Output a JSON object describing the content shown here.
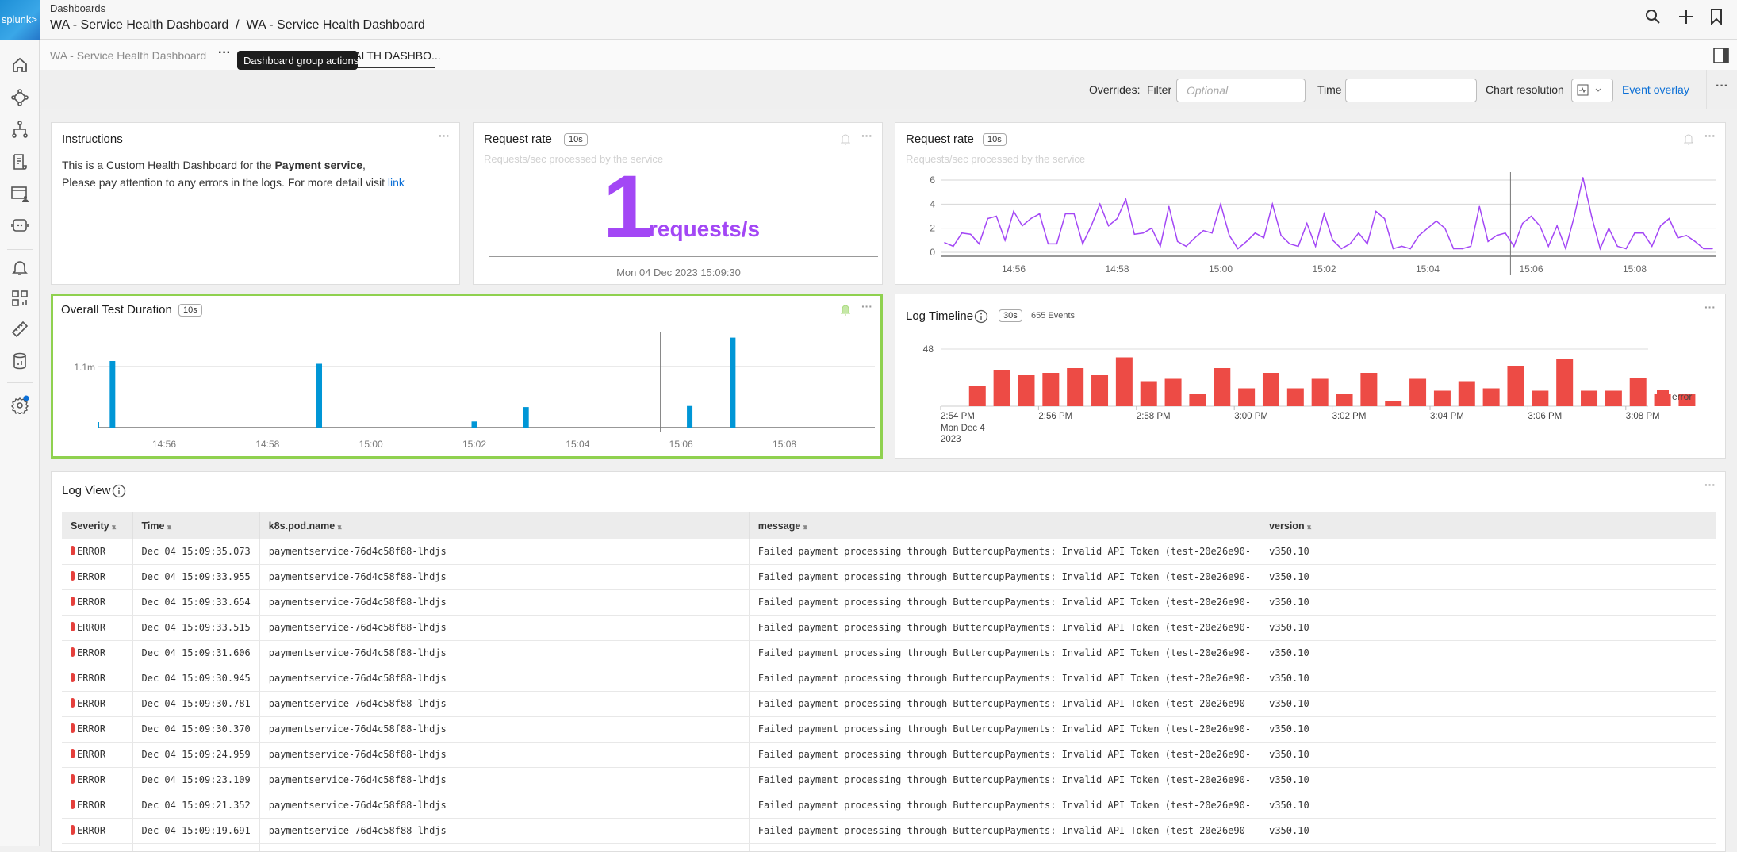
{
  "header": {
    "logo": "splunk>",
    "breadcrumb": "Dashboards",
    "title": "WA - Service Health Dashboard  /  WA - Service Health Dashboard",
    "icons": [
      "search-icon",
      "plus-icon",
      "bookmark-icon"
    ]
  },
  "sidebar": {
    "items": [
      "home",
      "service-map",
      "hierarchy",
      "logs",
      "synthetics",
      "bot",
      "alerts",
      "dashboards",
      "ruler",
      "database",
      "settings"
    ]
  },
  "tabs": {
    "group_name": "WA - Service Health Dashboard",
    "tooltip": "Dashboard group actions",
    "active_tab": "WA - SERVICE HEALTH DASHBO..."
  },
  "overrides": {
    "label": "Overrides:",
    "filter_label": "Filter",
    "filter_placeholder": "Optional",
    "filter_value": "",
    "time_label": "Time",
    "time_value": "",
    "resolution_label": "Chart resolution",
    "event_overlay": "Event overlay"
  },
  "colors": {
    "purple": "#a347f5",
    "blue": "#0096d6",
    "red": "#ed4b45",
    "highlight": "#8fd14f",
    "link": "#0b6fd6"
  },
  "instructions": {
    "title": "Instructions",
    "line1_pre": "This is a Custom Health Dashboard for the ",
    "line1_bold": "Payment service",
    "line1_post": ",",
    "line2": "Please pay attention to any errors in the logs. For more detail visit ",
    "link": "link"
  },
  "single_value": {
    "title": "Request rate",
    "resolution": "10s",
    "description": "Requests/sec processed by the service",
    "value": "1",
    "unit": "requests/s",
    "timestamp": "Mon 04 Dec 2023 15:09:30"
  },
  "log_view": {
    "title": "Log View",
    "columns": [
      "Severity",
      "Time",
      "k8s.pod.name",
      "message",
      "version"
    ],
    "rows": [
      [
        "ERROR",
        "Dec 04 15:09:35.073",
        "paymentservice-76d4c58f88-lhdjs",
        "Failed payment processing through ButtercupPayments: Invalid API Token (test-20e26e90-",
        "v350.10"
      ],
      [
        "ERROR",
        "Dec 04 15:09:33.955",
        "paymentservice-76d4c58f88-lhdjs",
        "Failed payment processing through ButtercupPayments: Invalid API Token (test-20e26e90-",
        "v350.10"
      ],
      [
        "ERROR",
        "Dec 04 15:09:33.654",
        "paymentservice-76d4c58f88-lhdjs",
        "Failed payment processing through ButtercupPayments: Invalid API Token (test-20e26e90-",
        "v350.10"
      ],
      [
        "ERROR",
        "Dec 04 15:09:33.515",
        "paymentservice-76d4c58f88-lhdjs",
        "Failed payment processing through ButtercupPayments: Invalid API Token (test-20e26e90-",
        "v350.10"
      ],
      [
        "ERROR",
        "Dec 04 15:09:31.606",
        "paymentservice-76d4c58f88-lhdjs",
        "Failed payment processing through ButtercupPayments: Invalid API Token (test-20e26e90-",
        "v350.10"
      ],
      [
        "ERROR",
        "Dec 04 15:09:30.945",
        "paymentservice-76d4c58f88-lhdjs",
        "Failed payment processing through ButtercupPayments: Invalid API Token (test-20e26e90-",
        "v350.10"
      ],
      [
        "ERROR",
        "Dec 04 15:09:30.781",
        "paymentservice-76d4c58f88-lhdjs",
        "Failed payment processing through ButtercupPayments: Invalid API Token (test-20e26e90-",
        "v350.10"
      ],
      [
        "ERROR",
        "Dec 04 15:09:30.370",
        "paymentservice-76d4c58f88-lhdjs",
        "Failed payment processing through ButtercupPayments: Invalid API Token (test-20e26e90-",
        "v350.10"
      ],
      [
        "ERROR",
        "Dec 04 15:09:24.959",
        "paymentservice-76d4c58f88-lhdjs",
        "Failed payment processing through ButtercupPayments: Invalid API Token (test-20e26e90-",
        "v350.10"
      ],
      [
        "ERROR",
        "Dec 04 15:09:23.109",
        "paymentservice-76d4c58f88-lhdjs",
        "Failed payment processing through ButtercupPayments: Invalid API Token (test-20e26e90-",
        "v350.10"
      ],
      [
        "ERROR",
        "Dec 04 15:09:21.352",
        "paymentservice-76d4c58f88-lhdjs",
        "Failed payment processing through ButtercupPayments: Invalid API Token (test-20e26e90-",
        "v350.10"
      ],
      [
        "ERROR",
        "Dec 04 15:09:19.691",
        "paymentservice-76d4c58f88-lhdjs",
        "Failed payment processing through ButtercupPayments: Invalid API Token (test-20e26e90-",
        "v350.10"
      ]
    ]
  },
  "chart_data": [
    {
      "id": "request-rate",
      "type": "line",
      "title": "Request rate",
      "resolution": "10s",
      "subtitle": "Requests/sec processed by the service",
      "color": "#a347f5",
      "ylim": [
        0,
        6.6
      ],
      "yticks": [
        0,
        2,
        4,
        6
      ],
      "xticks": [
        "14:56",
        "14:58",
        "15:00",
        "15:02",
        "15:04",
        "15:06",
        "15:08"
      ],
      "cursor": "15:05:36",
      "grid": true,
      "x": [
        "14:54:40",
        "14:54:50",
        "14:55:00",
        "14:55:10",
        "14:55:20",
        "14:55:30",
        "14:55:40",
        "14:55:50",
        "14:56:00",
        "14:56:10",
        "14:56:20",
        "14:56:30",
        "14:56:40",
        "14:56:50",
        "14:57:00",
        "14:57:10",
        "14:57:20",
        "14:57:30",
        "14:57:40",
        "14:57:50",
        "14:58:00",
        "14:58:10",
        "14:58:20",
        "14:58:30",
        "14:58:40",
        "14:58:50",
        "14:59:00",
        "14:59:10",
        "14:59:20",
        "14:59:30",
        "14:59:40",
        "14:59:50",
        "15:00:00",
        "15:00:10",
        "15:00:20",
        "15:00:30",
        "15:00:40",
        "15:00:50",
        "15:01:00",
        "15:01:10",
        "15:01:20",
        "15:01:30",
        "15:01:40",
        "15:01:50",
        "15:02:00",
        "15:02:10",
        "15:02:20",
        "15:02:30",
        "15:02:40",
        "15:02:50",
        "15:03:00",
        "15:03:10",
        "15:03:20",
        "15:03:30",
        "15:03:40",
        "15:03:50",
        "15:04:00",
        "15:04:10",
        "15:04:20",
        "15:04:30",
        "15:04:40",
        "15:04:50",
        "15:05:00",
        "15:05:10",
        "15:05:20",
        "15:05:30",
        "15:05:40",
        "15:05:50",
        "15:06:00",
        "15:06:10",
        "15:06:20",
        "15:06:30",
        "15:06:40",
        "15:06:50",
        "15:07:00",
        "15:07:10",
        "15:07:20",
        "15:07:30",
        "15:07:40",
        "15:07:50",
        "15:08:00",
        "15:08:10",
        "15:08:20",
        "15:08:30",
        "15:08:40",
        "15:08:50",
        "15:09:00",
        "15:09:10",
        "15:09:20",
        "15:09:30"
      ],
      "values": [
        0.8,
        0.5,
        1.6,
        1.5,
        0.7,
        2.8,
        3.0,
        1.0,
        3.4,
        2.2,
        2.8,
        3.2,
        0.7,
        0.7,
        3.2,
        3.2,
        0.7,
        2.2,
        4.0,
        2.2,
        2.8,
        4.4,
        1.5,
        1.6,
        2.0,
        0.5,
        3.8,
        0.9,
        0.5,
        1.2,
        1.8,
        1.6,
        4.0,
        1.4,
        0.3,
        0.9,
        1.6,
        1.2,
        4.0,
        1.4,
        0.7,
        0.5,
        2.4,
        0.5,
        3.2,
        1.0,
        0.3,
        0.7,
        1.6,
        0.7,
        3.4,
        2.8,
        0.3,
        0.5,
        0.3,
        1.4,
        2.0,
        2.6,
        2.0,
        0.3,
        0.3,
        0.5,
        3.8,
        0.9,
        1.4,
        1.6,
        0.5,
        2.4,
        3.0,
        2.2,
        0.5,
        2.2,
        0.3,
        3.0,
        6.2,
        3.0,
        0.3,
        2.0,
        0.5,
        0.3,
        1.6,
        1.6,
        0.5,
        2.2,
        2.8,
        1.2,
        1.4,
        0.9,
        0.3,
        0.3
      ]
    },
    {
      "id": "overall-test-duration",
      "type": "bar",
      "title": "Overall Test Duration",
      "resolution": "10s",
      "color": "#0096d6",
      "yticks": [
        {
          "value": 1100000,
          "label": "1.1m"
        }
      ],
      "ylim": [
        0,
        1750000
      ],
      "xticks": [
        "14:56",
        "14:58",
        "15:00",
        "15:02",
        "15:04",
        "15:06",
        "15:08"
      ],
      "cursor": "15:05:36",
      "grid": true,
      "x": [
        "14:54:40",
        "14:55:00",
        "14:59:00",
        "15:02:00",
        "15:03:00",
        "15:06:10",
        "15:07:00"
      ],
      "values": [
        100000,
        1200000,
        1150000,
        110000,
        370000,
        390000,
        1620000
      ]
    },
    {
      "id": "log-timeline",
      "type": "bar",
      "title": "Log Timeline",
      "resolution": "30s",
      "count_label": "655 Events",
      "color": "#ed4b45",
      "legend": "error",
      "legend_position": "right",
      "yticks": [
        48
      ],
      "ylim": [
        0,
        48
      ],
      "xticks": [
        "2:54 PM",
        "2:56 PM",
        "2:58 PM",
        "3:00 PM",
        "3:02 PM",
        "3:04 PM",
        "3:06 PM",
        "3:08 PM"
      ],
      "xtick_date": [
        "Mon Dec 4",
        "2023"
      ],
      "grid": true,
      "x": [
        "2:54:30",
        "2:55:00",
        "2:55:30",
        "2:56:00",
        "2:56:30",
        "2:57:00",
        "2:57:30",
        "2:58:00",
        "2:58:30",
        "2:59:00",
        "2:59:30",
        "3:00:00",
        "3:00:30",
        "3:01:00",
        "3:01:30",
        "3:02:00",
        "3:02:30",
        "3:03:00",
        "3:03:30",
        "3:04:00",
        "3:04:30",
        "3:05:00",
        "3:05:30",
        "3:06:00",
        "3:06:30",
        "3:07:00",
        "3:07:30",
        "3:08:00",
        "3:08:30",
        "3:09:00"
      ],
      "values": [
        17,
        30,
        26,
        28,
        32,
        26,
        41,
        21,
        23,
        10,
        32,
        15,
        28,
        15,
        23,
        10,
        28,
        4,
        23,
        13,
        21,
        15,
        34,
        13,
        40,
        13,
        13,
        24,
        10,
        10
      ]
    }
  ]
}
